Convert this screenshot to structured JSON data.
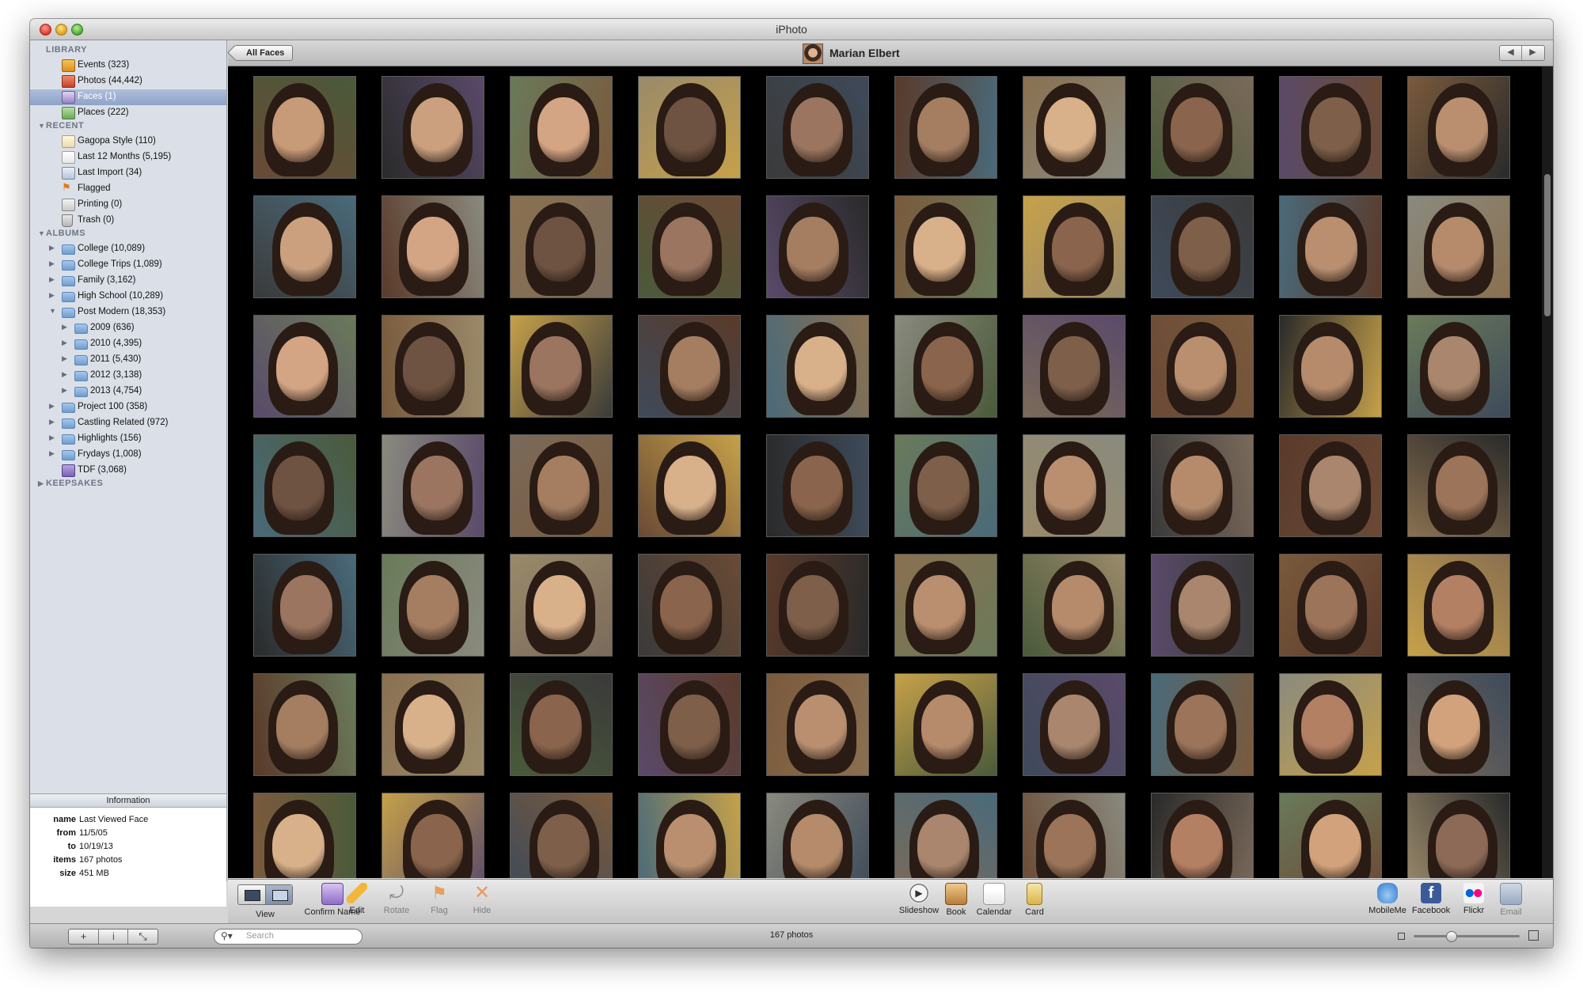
{
  "window": {
    "title": "iPhoto"
  },
  "sidebar": {
    "sections": {
      "library": "LIBRARY",
      "recent": "RECENT",
      "albums": "ALBUMS",
      "keepsakes": "KEEPSAKES"
    },
    "library": [
      {
        "label": "Events (323)",
        "icon": "events-icon"
      },
      {
        "label": "Photos (44,442)",
        "icon": "photos-icon"
      },
      {
        "label": "Faces (1)",
        "icon": "faces-icon",
        "selected": true
      },
      {
        "label": "Places (222)",
        "icon": "places-icon"
      }
    ],
    "recent": [
      {
        "label": "Gagopa Style (110)",
        "icon": "album-icon"
      },
      {
        "label": "Last 12 Months (5,195)",
        "icon": "calendar-icon"
      },
      {
        "label": "Last Import (34)",
        "icon": "import-icon"
      },
      {
        "label": "Flagged",
        "icon": "flag-icon"
      },
      {
        "label": "Printing (0)",
        "icon": "printer-icon"
      },
      {
        "label": "Trash (0)",
        "icon": "trash-icon"
      }
    ],
    "albums": [
      {
        "label": "College (10,089)",
        "level": 0,
        "disclosure": "closed"
      },
      {
        "label": "College Trips (1,089)",
        "level": 0,
        "disclosure": "closed"
      },
      {
        "label": "Family (3,162)",
        "level": 0,
        "disclosure": "closed"
      },
      {
        "label": "High School (10,289)",
        "level": 0,
        "disclosure": "closed"
      },
      {
        "label": "Post Modern (18,353)",
        "level": 0,
        "disclosure": "open"
      },
      {
        "label": "2009 (636)",
        "level": 1,
        "disclosure": "closed"
      },
      {
        "label": "2010 (4,395)",
        "level": 1,
        "disclosure": "closed"
      },
      {
        "label": "2011 (5,430)",
        "level": 1,
        "disclosure": "closed"
      },
      {
        "label": "2012 (3,138)",
        "level": 1,
        "disclosure": "closed"
      },
      {
        "label": "2013 (4,754)",
        "level": 1,
        "disclosure": "closed"
      },
      {
        "label": "Project 100 (358)",
        "level": 0,
        "disclosure": "closed"
      },
      {
        "label": "Castling Related (972)",
        "level": 0,
        "disclosure": "closed"
      },
      {
        "label": "Highlights (156)",
        "level": 0,
        "disclosure": "closed"
      },
      {
        "label": "Frydays (1,008)",
        "level": 0,
        "disclosure": "closed"
      },
      {
        "label": "TDF (3,068)",
        "level": 0,
        "disclosure": "none",
        "smart": true
      }
    ]
  },
  "info": {
    "heading": "Information",
    "rows": [
      {
        "key": "name",
        "value": "Last Viewed Face"
      },
      {
        "key": "from",
        "value": "11/5/05"
      },
      {
        "key": "to",
        "value": "10/19/13"
      },
      {
        "key": "items",
        "value": "167 photos"
      },
      {
        "key": "size",
        "value": "451 MB"
      }
    ]
  },
  "navbar": {
    "back_label": "All Faces",
    "person_name": "Marian Elbert",
    "prev_icon": "arrow-left-icon",
    "next_icon": "arrow-right-icon"
  },
  "grid": {
    "columns": 10,
    "rows": 7,
    "tones": [
      "#c79a78",
      "#a9866d",
      "#d4a585",
      "#b48064",
      "#9b7560",
      "#8d6a57",
      "#d8b08a",
      "#c3926d",
      "#7e5f4a",
      "#e2bd99",
      "#b58b6c",
      "#caa07f",
      "#9c7459",
      "#6f5342",
      "#d1a27b",
      "#a57e62",
      "#bf9473",
      "#8a644c",
      "#e0b892",
      "#b98f70"
    ],
    "backgrounds": [
      "#6a4a35",
      "#8a8a7e",
      "#3e4a5a",
      "#7a5a3c",
      "#4a5a3a",
      "#5a3a2a",
      "#9a8a6a",
      "#2a2a2a",
      "#7a6a5a",
      "#4a6a7a",
      "#c6a14a",
      "#5a4a6a",
      "#8a7050",
      "#3a3a3a",
      "#6a7a5a"
    ]
  },
  "toolbar": {
    "left": [
      {
        "label": "View",
        "icon": "view-icon"
      },
      {
        "label": "Confirm Name",
        "icon": "confirm-name-icon"
      },
      {
        "label": "Edit",
        "icon": "pencil-icon"
      },
      {
        "label": "Rotate",
        "icon": "rotate-icon",
        "disabled": true
      },
      {
        "label": "Flag",
        "icon": "flag-icon",
        "disabled": true
      },
      {
        "label": "Hide",
        "icon": "hide-icon",
        "disabled": true
      }
    ],
    "center": [
      {
        "label": "Slideshow",
        "icon": "play-icon"
      },
      {
        "label": "Book",
        "icon": "book-icon"
      },
      {
        "label": "Calendar",
        "icon": "calendar-icon"
      },
      {
        "label": "Card",
        "icon": "card-icon"
      }
    ],
    "right": [
      {
        "label": "MobileMe",
        "icon": "mobileme-icon"
      },
      {
        "label": "Facebook",
        "icon": "facebook-icon"
      },
      {
        "label": "Flickr",
        "icon": "flickr-icon"
      },
      {
        "label": "Email",
        "icon": "email-icon",
        "disabled": true
      }
    ]
  },
  "statusbar": {
    "add_label": "+",
    "info_label": "i",
    "fullscreen_label": "⤡",
    "search_placeholder": "Search",
    "photo_count": "167 photos",
    "zoom_level": 0.35
  },
  "colors": {
    "selection": "#8ea3c8",
    "grid_background": "#000000",
    "sidebar": "#dbe0e8"
  }
}
